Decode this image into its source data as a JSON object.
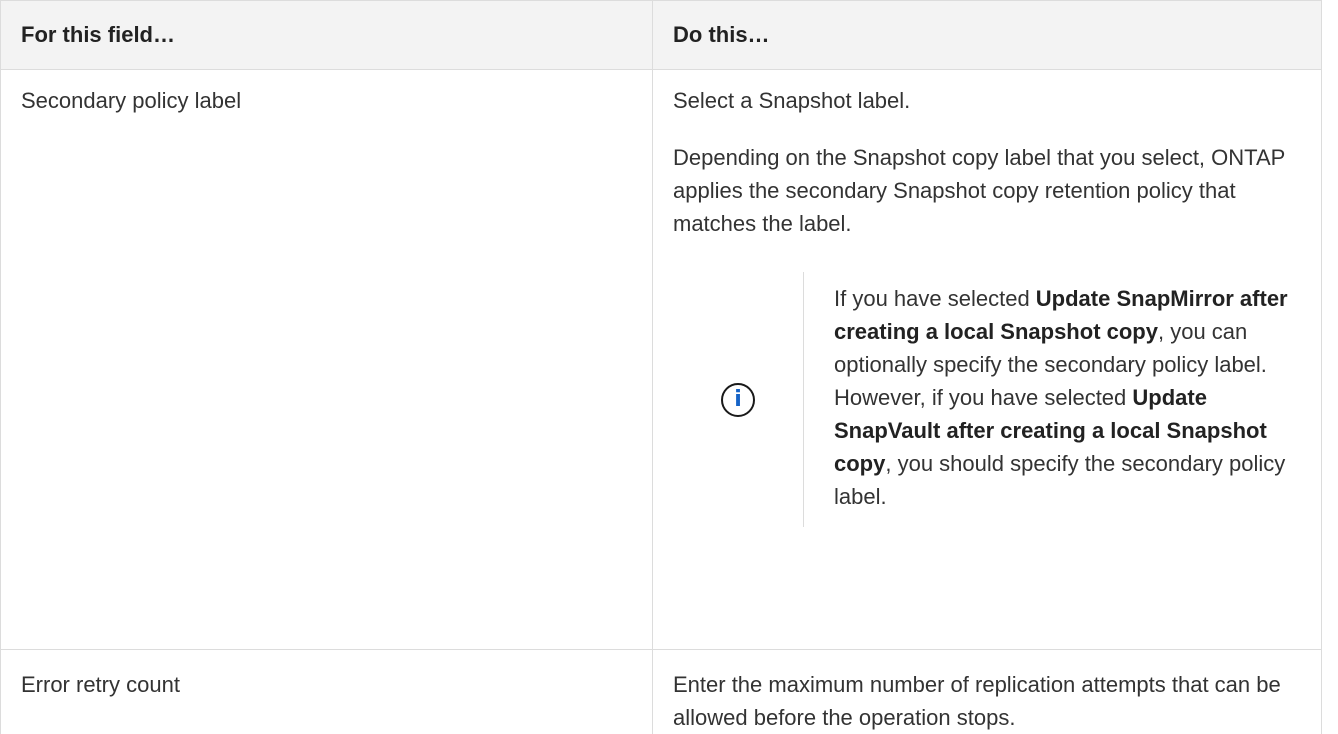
{
  "table": {
    "headers": [
      "For this field…",
      "Do this…"
    ],
    "rows": [
      {
        "field": "Secondary policy label",
        "action": {
          "line1": "Select a Snapshot label.",
          "line2": "Depending on the Snapshot copy label that you select, ONTAP applies the secondary Snapshot copy retention policy that matches the label.",
          "note": {
            "icon": "info-icon",
            "icon_glyph": "i",
            "text1": "If you have selected ",
            "bold1": "Update SnapMirror after creating a local Snapshot copy",
            "text2": ", you can optionally specify the secondary policy label. However, if you have selected ",
            "bold2": "Update SnapVault after creating a local Snapshot copy",
            "text3": ", you should specify the secondary policy label."
          }
        }
      },
      {
        "field": "Error retry count",
        "action": {
          "line1": "Enter the maximum number of replication attempts that can be allowed before the operation stops."
        }
      }
    ]
  },
  "colors": {
    "header_bg": "#f3f3f3",
    "border": "#dcdcdc",
    "info_icon": "#1563c7"
  }
}
